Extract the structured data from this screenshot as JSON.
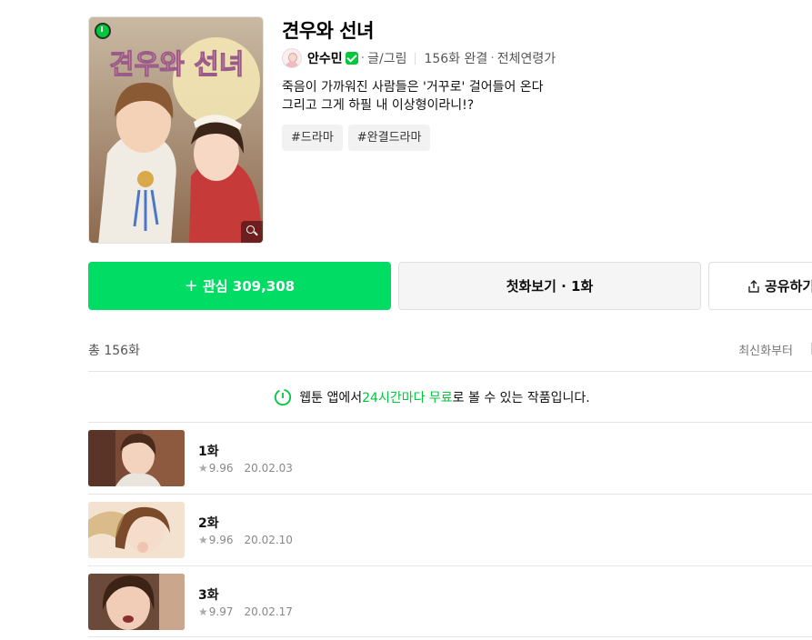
{
  "colors": {
    "accent": "#00dc64",
    "brand_green": "#00c73c"
  },
  "cover": {
    "title_art": "견우와 선녀"
  },
  "series": {
    "title": "견우와 선녀",
    "author": "안수민",
    "role": "글/그림",
    "episode_status": "156화 완결",
    "rating": "전체연령가",
    "description_line1": "죽음이 가까워진 사람들은 '거꾸로' 걸어들어 온다",
    "description_line2": "그리고 그게 하필 내 이상형이라니!?",
    "tags": [
      "#드라마",
      "#완결드라마"
    ]
  },
  "actions": {
    "favorite_label": "관심",
    "favorite_count": "309,308",
    "first_episode_label": "첫화보기 · 1화",
    "share_label": "공유하기"
  },
  "list": {
    "total": "총 156화",
    "sort": "최신화부터",
    "notice_prefix": "웹툰 앱에서 ",
    "notice_highlight": "24시간마다 무료",
    "notice_suffix": "로 볼 수 있는 작품입니다.",
    "episodes": [
      {
        "title": "1화",
        "rating": "9.96",
        "date": "20.02.03"
      },
      {
        "title": "2화",
        "rating": "9.96",
        "date": "20.02.10"
      },
      {
        "title": "3화",
        "rating": "9.97",
        "date": "20.02.17"
      }
    ]
  }
}
